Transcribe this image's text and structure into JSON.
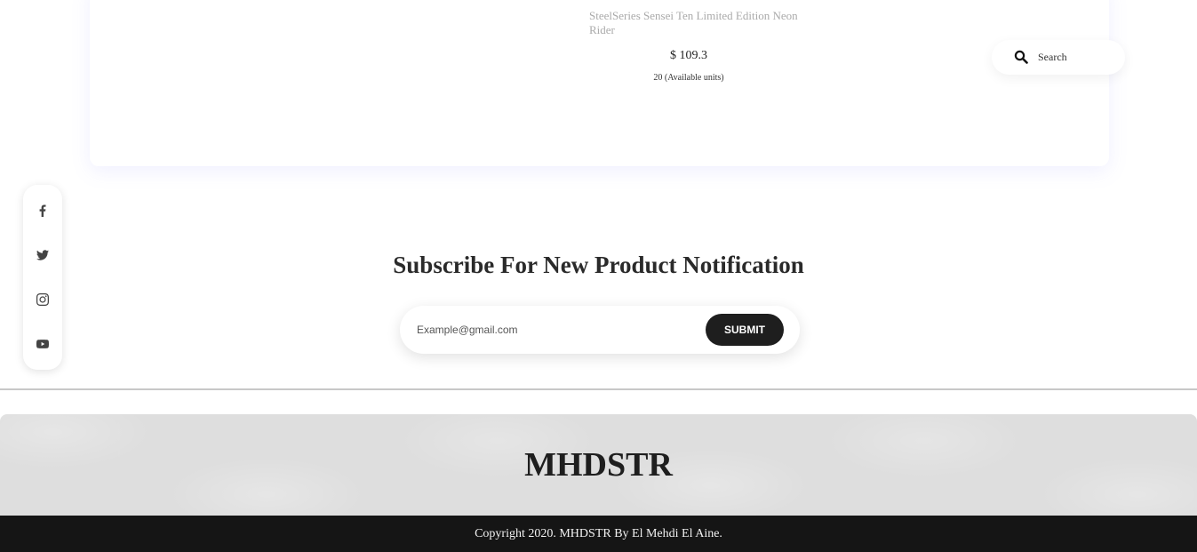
{
  "product": {
    "name": "SteelSeries Sensei Ten Limited Edition Neon Rider",
    "price": "$ 109.3",
    "stock": "20 (Available units)"
  },
  "search": {
    "placeholder": "Search",
    "icon": "search-icon"
  },
  "social": {
    "icons": [
      "facebook-icon",
      "twitter-icon",
      "instagram-icon",
      "youtube-icon"
    ]
  },
  "subscribe": {
    "title": "Subscribe For New Product Notification",
    "email_placeholder": "Example@gmail.com",
    "submit_label": "SUBMIT"
  },
  "footer": {
    "brand": "MHDSTR",
    "copyright": "Copyright 2020. MHDSTR By El Mehdi El Aine."
  },
  "colors": {
    "dark": "#1e1e1e",
    "footer_bar": "#151515",
    "muted_text": "#aaaaaa"
  }
}
